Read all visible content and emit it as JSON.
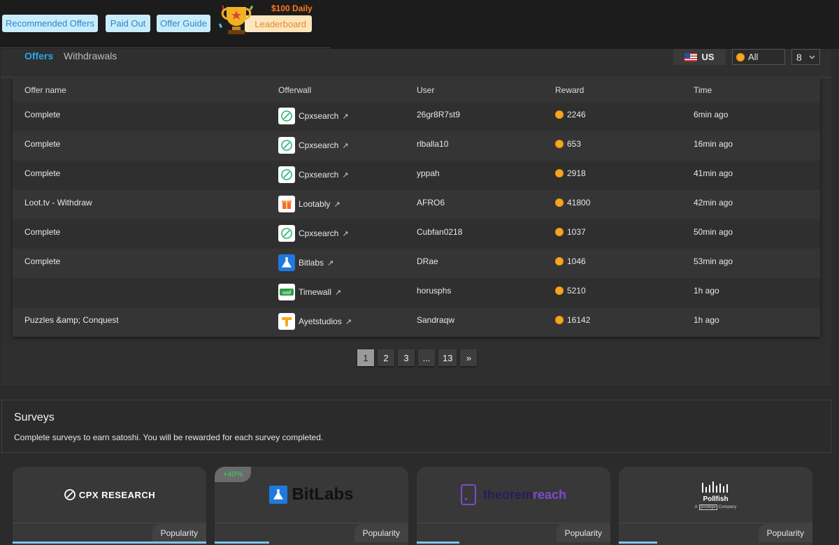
{
  "nav": {
    "recommended": "Recommended Offers",
    "paid_out": "Paid Out",
    "offer_guide": "Offer Guide",
    "daily": "$100 Daily",
    "leaderboard": "Leaderboard"
  },
  "tabs": {
    "offers": "Offers",
    "withdrawals": "Withdrawals"
  },
  "filters": {
    "country": "US",
    "all": "All",
    "per_page": "8"
  },
  "table": {
    "headers": [
      "Offer name",
      "Offerwall",
      "User",
      "Reward",
      "Time"
    ],
    "rows": [
      {
        "offer": "Complete",
        "wall": "Cpxsearch",
        "user": "26gr8R7st9",
        "reward": "2246",
        "time": "6min ago"
      },
      {
        "offer": "Complete",
        "wall": "Cpxsearch",
        "user": "rlballa10",
        "reward": "653",
        "time": "16min ago"
      },
      {
        "offer": "Complete",
        "wall": "Cpxsearch",
        "user": "yppah",
        "reward": "2918",
        "time": "41min ago"
      },
      {
        "offer": "Loot.tv - Withdraw",
        "wall": "Lootably",
        "user": "AFRO6",
        "reward": "41800",
        "time": "42min ago"
      },
      {
        "offer": "Complete",
        "wall": "Cpxsearch",
        "user": "Cubfan0218",
        "reward": "1037",
        "time": "50min ago"
      },
      {
        "offer": "Complete",
        "wall": "Bitlabs",
        "user": "DRae",
        "reward": "1046",
        "time": "53min ago"
      },
      {
        "offer": "",
        "wall": "Timewall",
        "user": "horusphs",
        "reward": "5210",
        "time": "1h ago"
      },
      {
        "offer": "Puzzles &amp; Conquest",
        "wall": "Ayetstudios",
        "user": "Sandraqw",
        "reward": "16142",
        "time": "1h ago"
      }
    ]
  },
  "pagination": [
    "1",
    "2",
    "3",
    "...",
    "13",
    "»"
  ],
  "surveys": {
    "title": "Surveys",
    "description": "Complete surveys to earn satoshi. You will be rewarded for each survey completed.",
    "cards": [
      {
        "logo_text": "CPX RESEARCH",
        "popularity": "Popularity",
        "popularity_level": 1.0
      },
      {
        "logo_text": "BitLabs",
        "badge": "+40%",
        "popularity": "Popularity",
        "popularity_level": 0.28
      },
      {
        "logo_text_a": "theorem",
        "logo_text_b": "reach",
        "popularity": "Popularity",
        "popularity_level": 0.22
      },
      {
        "logo_text": "Pollfish",
        "logo_sub_a": "A",
        "logo_sub_b": "prodege",
        "logo_sub_c": "Company",
        "popularity": "Popularity",
        "popularity_level": 0.2
      }
    ]
  },
  "colors": {
    "accent_blue": "#2ba7e6",
    "coin": "#f5a623",
    "nav_button_bg": "#c9ecfb",
    "leaderboard": "#e58a2c"
  }
}
